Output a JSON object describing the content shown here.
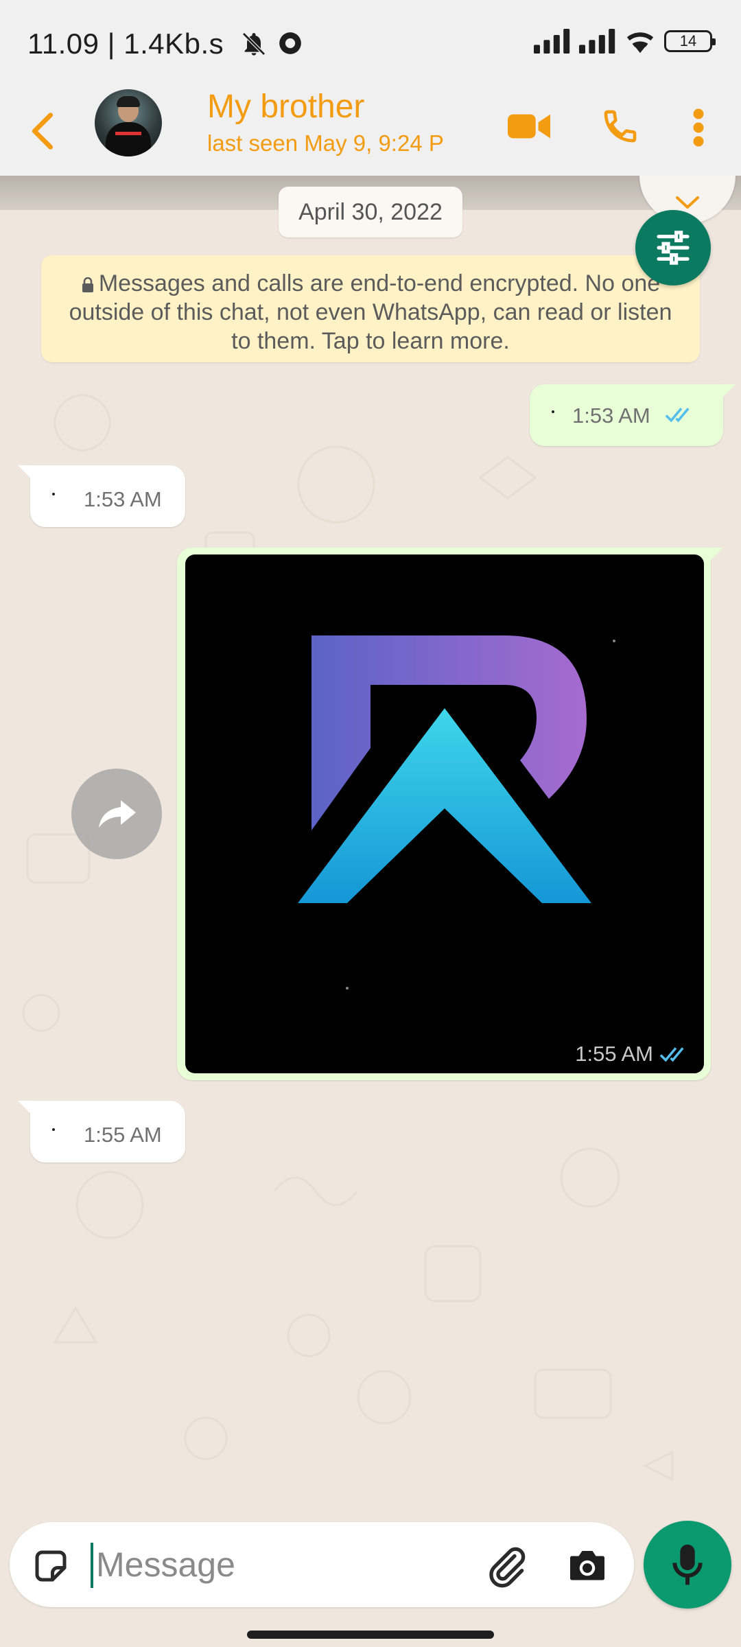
{
  "status_bar": {
    "text": "11.09 | 1.4Kb.s",
    "battery": "14",
    "icons": [
      "bell-off-icon",
      "record-icon",
      "signal-icon",
      "signal-icon",
      "wifi-icon",
      "battery-icon"
    ]
  },
  "header": {
    "contact_name": "My brother",
    "last_seen": "last seen May 9, 9:24 P",
    "accent_color": "#f39c12",
    "icons": [
      "back-arrow-icon",
      "video-call-icon",
      "voice-call-icon",
      "more-options-icon"
    ]
  },
  "chat": {
    "date_chip": "April 30, 2022",
    "encryption_notice": "Messages and calls are end-to-end encrypted. No one outside of this chat, not even WhatsApp, can read or listen to them. Tap to learn more.",
    "messages": [
      {
        "direction": "outgoing",
        "text": "·",
        "time": "1:53 AM",
        "status": "read"
      },
      {
        "direction": "incoming",
        "text": "·",
        "time": "1:53 AM"
      },
      {
        "direction": "outgoing",
        "type": "image",
        "time": "1:55 AM",
        "status": "read"
      },
      {
        "direction": "incoming",
        "text": "·",
        "time": "1:55 AM"
      }
    ]
  },
  "composer": {
    "placeholder": "Message",
    "value": "",
    "icons": [
      "sticker-icon",
      "attach-icon",
      "camera-icon",
      "mic-icon"
    ],
    "mic_color": "#0b9a70"
  },
  "colors": {
    "read_ticks": "#53bdeb",
    "outgoing_bubble": "#e7fed7",
    "chat_background": "#efe7dd",
    "notice_background": "#fff2c6"
  }
}
